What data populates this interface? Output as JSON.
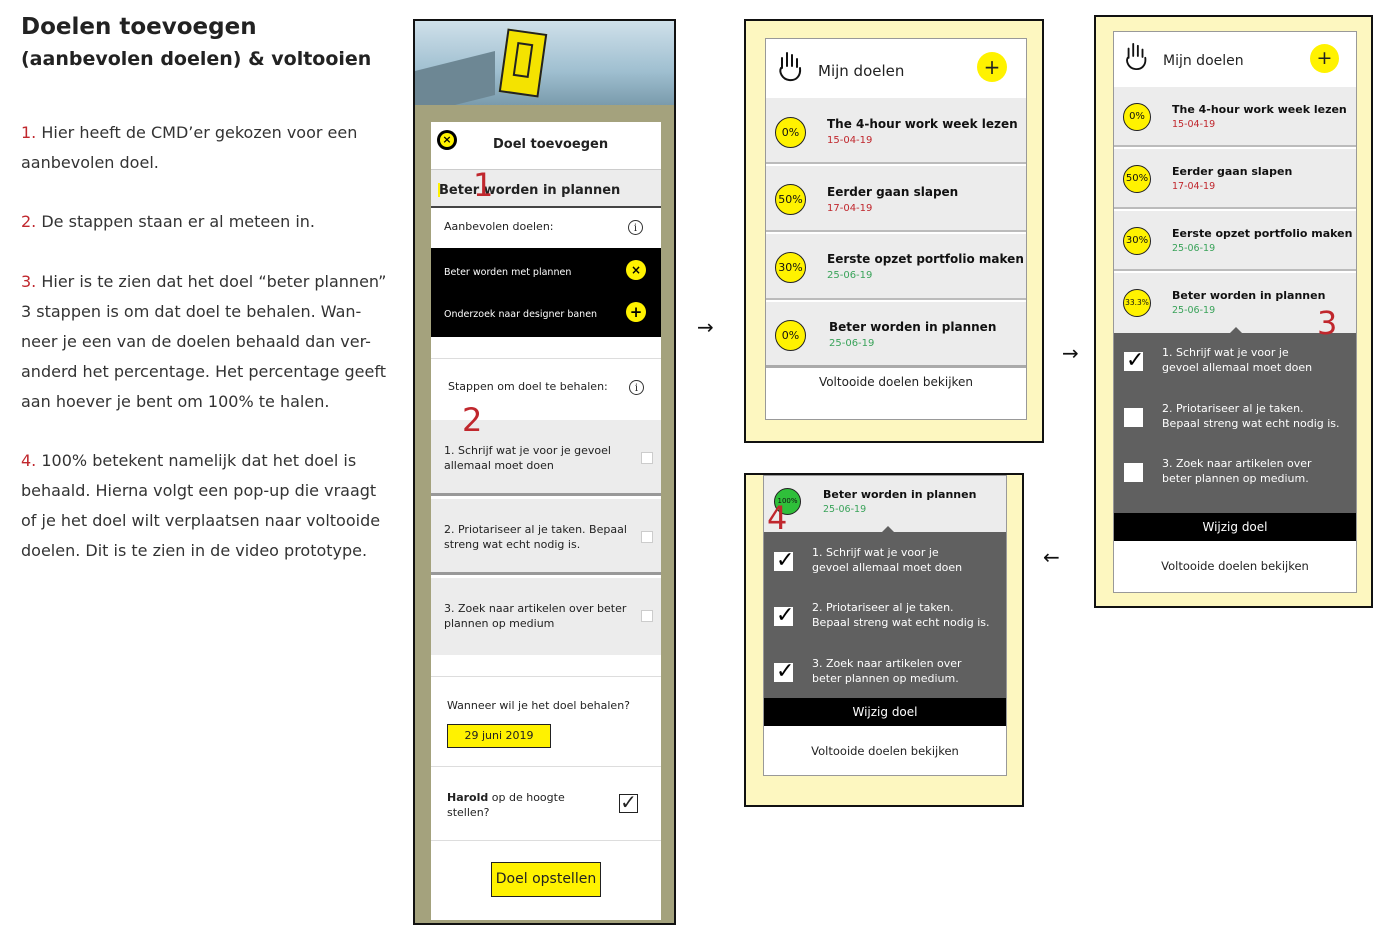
{
  "heading": {
    "title": "Doelen toevoegen",
    "subtitle": "(aanbevolen doelen) & voltooien"
  },
  "paragraphs": [
    {
      "num": "1.",
      "lines": [
        "Hier heeft de CMD’er gekozen voor een",
        "aanbevolen doel."
      ]
    },
    {
      "num": "2.",
      "lines": [
        "De stappen staan er al meteen in."
      ]
    },
    {
      "num": "3.",
      "lines": [
        "Hier is te zien dat het doel “beter plannen”",
        "3 stappen is om dat doel te behalen. Wan-",
        "neer je een van de doelen behaald dan ver-",
        "anderd het percentage. Het percentage geeft",
        "aan hoever je bent om 100% te halen."
      ]
    },
    {
      "num": "4.",
      "lines": [
        "100% betekent namelijk dat het doel is",
        "behaald. Hierna volgt een pop-up die vraagt",
        "of je het doel wilt verplaatsen naar voltooide",
        "doelen. Dit is te zien in de video prototype."
      ]
    }
  ],
  "phone1": {
    "header_title": "Doel toevoegen",
    "goal_input": "Beter worden in plannen",
    "recommended_label": "Aanbevolen doelen:",
    "recommended": [
      {
        "label": "Beter worden met plannen",
        "action": "×"
      },
      {
        "label": "Onderzoek naar designer banen",
        "action": "+"
      }
    ],
    "steps_label": "Stappen om doel te behalen:",
    "steps": [
      {
        "line1": "1. Schrijf wat je voor je gevoel",
        "line2": "allemaal moet doen"
      },
      {
        "line1": "2. Priotariseer al je taken. Bepaal",
        "line2": "streng wat echt nodig is."
      },
      {
        "line1": "3. Zoek naar artikelen over beter",
        "line2": "plannen op medium"
      }
    ],
    "deadline_question": "Wanneer wil je het doel behalen?",
    "deadline_value": "29 juni 2019",
    "harold_bold": "Harold",
    "harold_rest": " op de hoogte",
    "harold_line2": "stellen?",
    "submit": "Doel opstellen"
  },
  "screen2": {
    "title": "Mijn doelen",
    "goals": [
      {
        "pct": "0%",
        "title": "The 4-hour work week lezen",
        "date": "15-04-19",
        "date_color": "red"
      },
      {
        "pct": "50%",
        "title": "Eerder gaan slapen",
        "date": "17-04-19",
        "date_color": "red"
      },
      {
        "pct": "30%",
        "title": "Eerste opzet portfolio maken",
        "date": "25-06-19",
        "date_color": "green"
      },
      {
        "pct": "0%",
        "title": "Beter worden in plannen",
        "date": "25-06-19",
        "date_color": "green"
      }
    ],
    "footer": "Voltooide doelen bekijken"
  },
  "screen3": {
    "title": "Mijn doelen",
    "goals": [
      {
        "pct": "0%",
        "title": "The 4-hour work week lezen",
        "date": "15-04-19",
        "date_color": "red"
      },
      {
        "pct": "50%",
        "title": "Eerder gaan slapen",
        "date": "17-04-19",
        "date_color": "red"
      },
      {
        "pct": "30%",
        "title": "Eerste opzet portfolio maken",
        "date": "25-06-19",
        "date_color": "green"
      },
      {
        "pct": "33.3%",
        "title": "Beter worden in plannen",
        "date": "25-06-19",
        "date_color": "green"
      }
    ],
    "steps": [
      {
        "checked": true,
        "line1": "1. Schrijf wat je voor je",
        "line2": "gevoel allemaal moet doen"
      },
      {
        "checked": false,
        "line1": "2. Priotariseer al je taken.",
        "line2": "Bepaal streng wat echt nodig is."
      },
      {
        "checked": false,
        "line1": "3. Zoek naar artikelen over",
        "line2": "beter plannen op medium."
      }
    ],
    "edit": "Wijzig doel",
    "footer": "Voltooide doelen bekijken"
  },
  "screen4": {
    "goal": {
      "pct": "100%",
      "title": "Beter worden in plannen",
      "date": "25-06-19"
    },
    "steps": [
      {
        "checked": true,
        "line1": "1. Schrijf wat je voor je",
        "line2": "gevoel allemaal moet doen"
      },
      {
        "checked": true,
        "line1": "2. Priotariseer al je taken.",
        "line2": "Bepaal streng wat echt nodig is."
      },
      {
        "checked": true,
        "line1": "3. Zoek naar artikelen over",
        "line2": "beter plannen op medium."
      }
    ],
    "edit": "Wijzig doel",
    "footer": "Voltooide doelen bekijken"
  },
  "annotations": {
    "a1": "1",
    "a2": "2",
    "a3": "3",
    "a4": "4"
  },
  "arrows": {
    "right": "→",
    "left": "←"
  },
  "glyphs": {
    "close": "×",
    "plus": "+",
    "info": "i",
    "check": "✓"
  },
  "icons": {
    "hand": "hand-icon"
  },
  "colors": {
    "accent_yellow": "#fff200",
    "annotation_red": "#c0272d",
    "frame_yellow": "#fdf7c0",
    "phone_bg": "#a4a27d",
    "date_red": "#c0272d",
    "date_green": "#3aa35a",
    "step_panel": "#606060",
    "done_green": "#2fbf3a"
  }
}
